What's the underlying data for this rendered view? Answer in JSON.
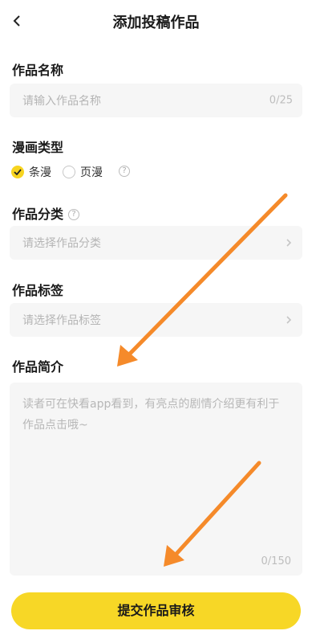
{
  "header": {
    "title": "添加投稿作品",
    "back_icon": "chevron-left-icon"
  },
  "name_section": {
    "label": "作品名称",
    "placeholder": "请输入作品名称",
    "counter": "0/25"
  },
  "comic_type": {
    "label": "漫画类型",
    "options": [
      {
        "label": "条漫",
        "selected": true
      },
      {
        "label": "页漫",
        "selected": false
      }
    ],
    "help_icon": "help-icon"
  },
  "category": {
    "label": "作品分类",
    "placeholder": "请选择作品分类"
  },
  "tags": {
    "label": "作品标签",
    "placeholder": "请选择作品标签"
  },
  "intro": {
    "label": "作品简介",
    "placeholder_line1": "读者可在快看app看到，有亮点的剧情介绍更有利于",
    "placeholder_line2": "作品点击哦~",
    "counter": "0/150"
  },
  "submit_label": "提交作品审核",
  "colors": {
    "accent": "#f7d726",
    "arrow": "#f58a2a",
    "field_bg": "#f6f6f6"
  }
}
